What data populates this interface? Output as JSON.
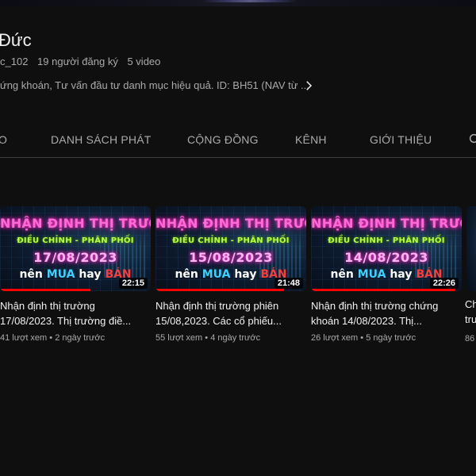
{
  "channel": {
    "name": "Đức",
    "handle": "c_102",
    "subscribers": "19 người đăng ký",
    "videos_count": "5 video",
    "description": "ứng khoán, Tư vấn đầu tư danh mục hiệu quả. ID: BH51 (NAV từ ...",
    "desc_more_icon": "chevron-right-icon"
  },
  "tabs": [
    {
      "label": "O"
    },
    {
      "label": "DANH SÁCH PHÁT"
    },
    {
      "label": "CỘNG ĐỒNG"
    },
    {
      "label": "KÊNH"
    },
    {
      "label": "GIỚI THIỆU"
    }
  ],
  "tab_search_icon": "search-icon",
  "videos": [
    {
      "thumb": {
        "line1": "NHẬN ĐỊNH THỊ TRƯỜNG",
        "line2": "ĐIỀU CHỈNH - PHÂN PHỐI",
        "line3": "17/08/2023",
        "line4_a": "nên ",
        "line4_mua": "MUA",
        "line4_b": " hay ",
        "line4_ban": "BÁN"
      },
      "duration": "22:15",
      "watched_fraction": 0.6,
      "title": "Nhận định thị trường 17/08/2023. Thị trường điề...",
      "views": "41 lượt xem",
      "sep": "•",
      "age": "2 ngày trước"
    },
    {
      "thumb": {
        "line1": "NHẬN ĐỊNH THỊ TRƯỜNG",
        "line2": "ĐIỀU CHỈNH - PHÂN PHỐI",
        "line3": "15/08/2023",
        "line4_a": "nên ",
        "line4_mua": "MUA",
        "line4_b": " hay ",
        "line4_ban": "BÁN"
      },
      "duration": "21:48",
      "watched_fraction": 0.85,
      "title": "Nhận định thị trường phiên 15/08,2023. Các cổ phiếu...",
      "views": "55 lượt xem",
      "sep": "•",
      "age": "4 ngày trước"
    },
    {
      "thumb": {
        "line1": "NHẬN ĐỊNH THỊ TRƯỜNG",
        "line2": "ĐIỀU CHỈNH - PHÂN PHỐI",
        "line3": "14/08/2023",
        "line4_a": "nên ",
        "line4_mua": "MUA",
        "line4_b": " hay ",
        "line4_ban": "BÁN"
      },
      "duration": "22:26",
      "watched_fraction": 0.95,
      "title": "Nhận định thị trường chứng khoán 14/08/2023. Thị...",
      "views": "26 lượt xem",
      "sep": "•",
      "age": "5 ngày trước"
    }
  ],
  "partial_video": {
    "title_line1": "Ch",
    "title_line2": "tru",
    "views": "86"
  },
  "colors": {
    "background": "#0f0f0f",
    "text_primary": "#f1f1f1",
    "text_secondary": "#aaaaaa",
    "progress": "#ff0000"
  }
}
